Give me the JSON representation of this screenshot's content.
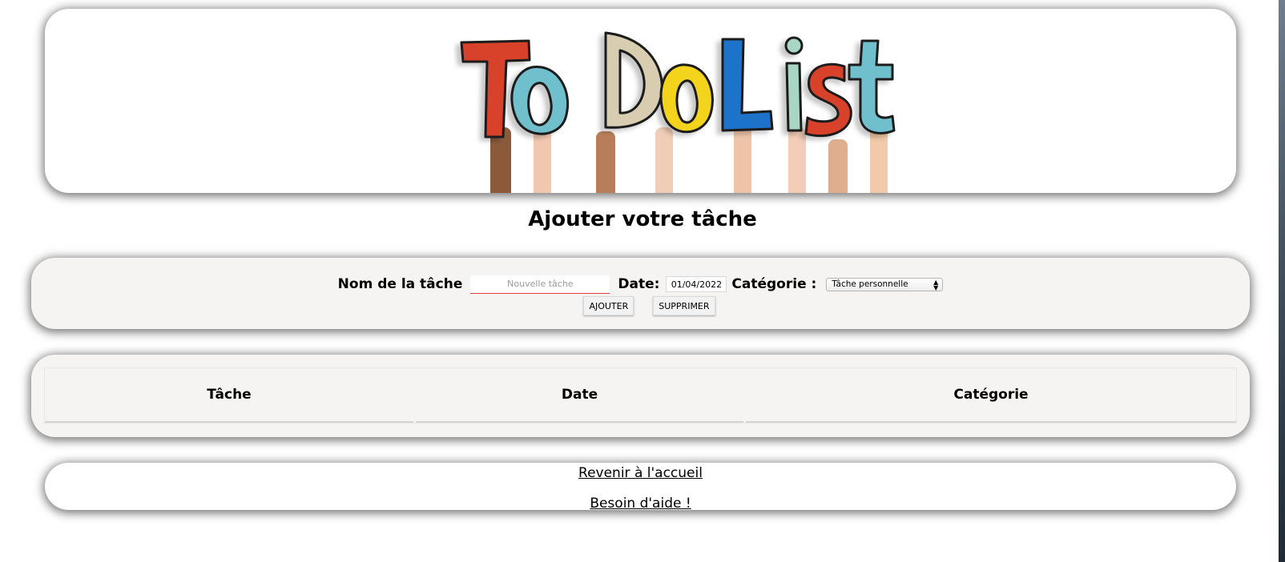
{
  "header": {
    "logo_text": "To Do List",
    "logo_letter_colors": [
      "#d9432b",
      "#6fbfcc",
      "#d8cdb0",
      "#f4d31d",
      "#1e73c9",
      "#a9d6c3",
      "#d9432b",
      "#6fbfcc"
    ]
  },
  "page_title": "Ajouter votre tâche",
  "form": {
    "task_label": "Nom de la tâche",
    "task_placeholder": "Nouvelle tâche",
    "task_value": "",
    "date_label": "Date:",
    "date_value": "01/04/2022",
    "category_label": "Catégorie :",
    "category_selected": "Tâche personnelle",
    "add_button": "AJOUTER",
    "delete_button": "SUPPRIMER"
  },
  "table": {
    "columns": [
      "Tâche",
      "Date",
      "Catégorie"
    ]
  },
  "footer": {
    "home_link": "Revenir à l'accueil",
    "help_link": "Besoin d'aide !"
  }
}
